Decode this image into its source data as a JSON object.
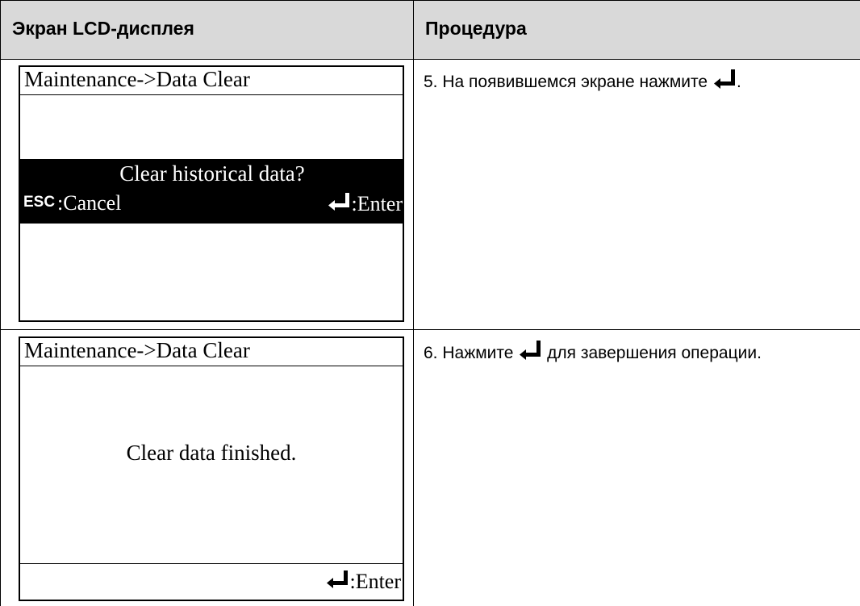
{
  "table": {
    "headers": [
      "Экран LCD-дисплея",
      "Процедура"
    ]
  },
  "rows": [
    {
      "lcd": {
        "title": "Maintenance->Data Clear",
        "dialog_question": "Clear historical data?",
        "esc_key": "ESC",
        "esc_label": ":Cancel",
        "enter_label": ":Enter",
        "enter_icon": "enter-key-icon"
      },
      "procedure": {
        "text_before": "5. На появившемся экране нажмите ",
        "text_after": ".",
        "icon": "enter-key-icon"
      }
    },
    {
      "lcd": {
        "title": "Maintenance->Data Clear",
        "message": "Clear data finished.",
        "enter_label": ":Enter",
        "enter_icon": "enter-key-icon"
      },
      "procedure": {
        "text_before": "6. Нажмите ",
        "text_after": " для завершения операции.",
        "icon": "enter-key-icon"
      }
    }
  ]
}
